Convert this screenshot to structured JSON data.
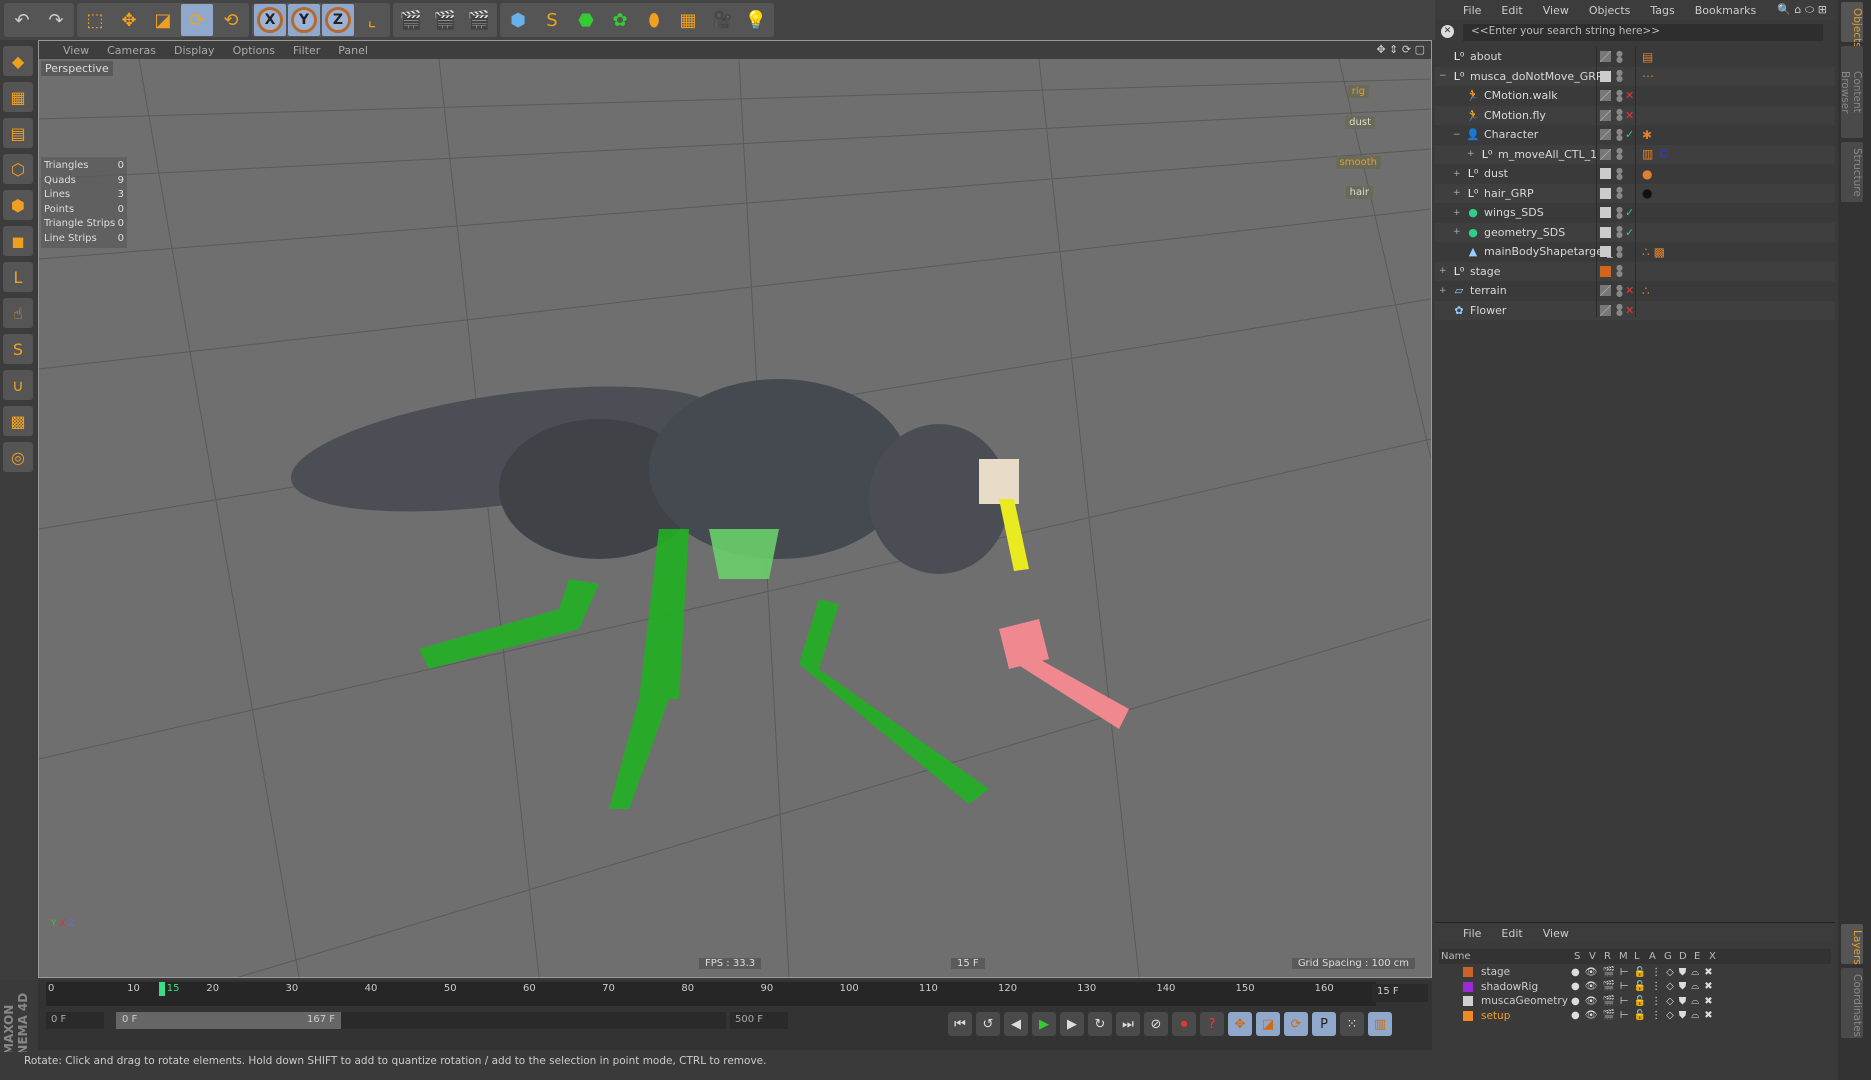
{
  "toolbar": {
    "groups": [
      [
        "undo-icon",
        "redo-icon"
      ],
      [
        "live-select-icon",
        "move-icon",
        "scale-icon",
        "rotate-icon",
        "rotate-recent-icon"
      ],
      [
        "x-axis-icon",
        "y-axis-icon",
        "z-axis-icon",
        "coordinate-system-icon"
      ],
      [
        "render-view-icon",
        "render-picture-viewer-icon",
        "render-settings-icon"
      ],
      [
        "cube-icon",
        "spline-pen-icon",
        "nurbs-icon",
        "array-icon",
        "deformer-icon",
        "floor-icon",
        "camera-icon",
        "light-icon"
      ]
    ],
    "axis_labels": [
      "X",
      "Y",
      "Z"
    ]
  },
  "viewport": {
    "menu": [
      "View",
      "Cameras",
      "Display",
      "Options",
      "Filter",
      "Panel"
    ],
    "camera": "Perspective",
    "stats": [
      {
        "label": "Triangles",
        "value": "0"
      },
      {
        "label": "Quads",
        "value": "9"
      },
      {
        "label": "Lines",
        "value": "3"
      },
      {
        "label": "Points",
        "value": "0"
      },
      {
        "label": "Triangle Strips",
        "value": "0"
      },
      {
        "label": "Line Strips",
        "value": "0"
      }
    ],
    "tags": [
      "rig",
      "dust",
      "smooth",
      "hair"
    ],
    "fps": "FPS : 33.3",
    "frame": "15 F",
    "grid": "Grid Spacing : 100 cm"
  },
  "timeline": {
    "ticks": [
      "0",
      "10",
      "15",
      "20",
      "30",
      "40",
      "50",
      "60",
      "70",
      "80",
      "90",
      "100",
      "110",
      "120",
      "130",
      "140",
      "150",
      "160"
    ],
    "current_frame": 15,
    "max_frame": 167,
    "current_field": "15 F",
    "start_field": "0 F",
    "range_start": "0 F",
    "range_end": "167 F",
    "end_field": "500 F"
  },
  "status": "Rotate: Click and drag to rotate elements. Hold down SHIFT to add to quantize rotation / add to the selection in point mode, CTRL to remove.",
  "logo": "MAXON CINEMA 4D",
  "object_manager": {
    "menu": [
      "File",
      "Edit",
      "View",
      "Objects",
      "Tags",
      "Bookmarks"
    ],
    "search_placeholder": "<<Enter your search string here>>",
    "objects": [
      {
        "name": "about",
        "indent": 0,
        "icon": "null-icon",
        "expand": "",
        "vis": "hatch",
        "flag": "",
        "tags": [
          "note-tag-icon"
        ]
      },
      {
        "name": "musca_doNotMove_GRP",
        "indent": 0,
        "icon": "null-icon",
        "expand": "−",
        "vis": "white",
        "flag": "",
        "tags": [
          "xpresso-tag-icon"
        ]
      },
      {
        "name": "CMotion.walk",
        "indent": 1,
        "icon": "cmotion-icon",
        "expand": "",
        "vis": "hatch",
        "flag": "x",
        "tags": []
      },
      {
        "name": "CMotion.fly",
        "indent": 1,
        "icon": "cmotion-icon",
        "expand": "",
        "vis": "hatch",
        "flag": "x",
        "tags": []
      },
      {
        "name": "Character",
        "indent": 1,
        "icon": "character-icon",
        "expand": "−",
        "vis": "hatch",
        "flag": "check",
        "tags": [
          "character-tag-icon"
        ]
      },
      {
        "name": "m_moveAll_CTL_1",
        "indent": 2,
        "icon": "null-icon",
        "expand": "+",
        "vis": "hatch",
        "flag": "",
        "tags": [
          "weight-tag-icon",
          "constraint-tag-icon"
        ]
      },
      {
        "name": "dust",
        "indent": 1,
        "icon": "null-icon",
        "expand": "+",
        "vis": "white",
        "flag": "",
        "tags": [
          "material-tag-icon"
        ]
      },
      {
        "name": "hair_GRP",
        "indent": 1,
        "icon": "null-icon",
        "expand": "+",
        "vis": "white",
        "flag": "",
        "tags": [
          "material-dark-tag-icon"
        ]
      },
      {
        "name": "wings_SDS",
        "indent": 1,
        "icon": "subdivision-icon",
        "expand": "+",
        "vis": "white",
        "flag": "check",
        "tags": []
      },
      {
        "name": "geometry_SDS",
        "indent": 1,
        "icon": "subdivision-icon",
        "expand": "+",
        "vis": "white",
        "flag": "check",
        "tags": []
      },
      {
        "name": "mainBodyShapetarget_",
        "indent": 1,
        "icon": "pose-morph-icon",
        "expand": "",
        "vis": "white",
        "flag": "",
        "tags": [
          "display-tag-icon",
          "checker-tag-icon"
        ]
      },
      {
        "name": "stage",
        "indent": 0,
        "icon": "null-icon",
        "expand": "+",
        "vis": "orange",
        "flag": "",
        "tags": []
      },
      {
        "name": "terrain",
        "indent": 0,
        "icon": "plane-icon",
        "expand": "+",
        "vis": "hatch",
        "flag": "x",
        "tags": [
          "display-tag-icon"
        ]
      },
      {
        "name": "Flower",
        "indent": 0,
        "icon": "flower-icon",
        "expand": "",
        "vis": "hatch",
        "flag": "x",
        "tags": []
      }
    ]
  },
  "side_tabs": [
    "Objects",
    "Content Browser",
    "Structure",
    "Layers",
    "Coordinates"
  ],
  "layers": {
    "menu": [
      "File",
      "Edit",
      "View"
    ],
    "columns": [
      "Name",
      "S",
      "V",
      "R",
      "M",
      "L",
      "A",
      "G",
      "D",
      "E",
      "X"
    ],
    "rows": [
      {
        "name": "stage",
        "color": "#c8642a"
      },
      {
        "name": "shadowRig",
        "color": "#9a2ad6"
      },
      {
        "name": "muscaGeometry",
        "color": "#d0d0d0"
      },
      {
        "name": "setup",
        "color": "#f08c1e",
        "active": true
      }
    ]
  },
  "colors": {
    "accent": "#f0a020",
    "leg_green": "#22b022",
    "leg_pink": "#f08890",
    "viewport_bg": "#6f6f6f",
    "selected": "#8fa8cc"
  }
}
